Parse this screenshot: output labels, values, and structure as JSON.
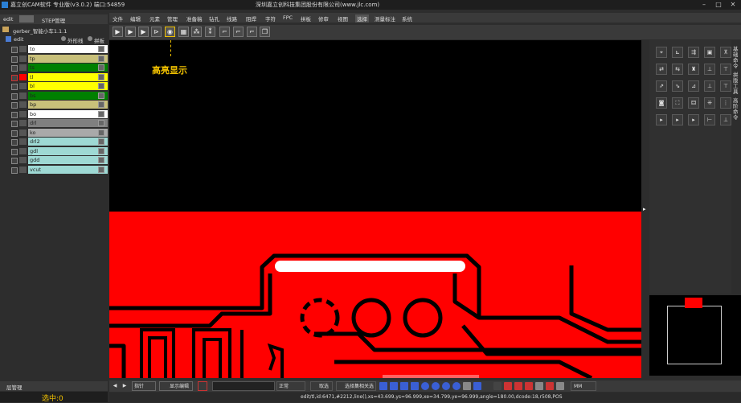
{
  "app": {
    "title": "嘉立创CAM软件 专业版(v3.0.2) 端口:54859",
    "company": "深圳嘉立创科技集团股份有限公司(www.jlc.com)"
  },
  "left": {
    "tabs": [
      "edit",
      "STEP管理"
    ],
    "job_name": "gerber_智能小车1.1.1",
    "step_name": "edit",
    "toggles": [
      "外形线",
      "拼板"
    ],
    "layers": [
      {
        "name": "to",
        "color": "#ffffff"
      },
      {
        "name": "tp",
        "color": "#c8c07a"
      },
      {
        "name": "ts",
        "color": "#008000"
      },
      {
        "name": "tl",
        "color": "#ffff00"
      },
      {
        "name": "bl",
        "color": "#ffff00"
      },
      {
        "name": "bs",
        "color": "#008000"
      },
      {
        "name": "bp",
        "color": "#c8c07a"
      },
      {
        "name": "bo",
        "color": "#ffffff"
      },
      {
        "name": "drl",
        "color": "#808080"
      },
      {
        "name": "ko",
        "color": "#a9a9a9"
      },
      {
        "name": "drl2",
        "color": "#9ed9d4"
      },
      {
        "name": "gdl",
        "color": "#9ed9d4"
      },
      {
        "name": "gdd",
        "color": "#9ed9d4"
      },
      {
        "name": "vcut",
        "color": "#9ed9d4"
      }
    ],
    "bottom_tab": "层管理",
    "selected_label": "选中:0"
  },
  "menu": [
    "文件",
    "编辑",
    "元素",
    "管理",
    "准备稿",
    "钻孔",
    "线路",
    "阻焊",
    "字符",
    "FPC",
    "拼板",
    "修审",
    "视图",
    "选择",
    "测量标注",
    "系统"
  ],
  "annotation": "高亮显示",
  "right_labels": [
    "基础命令",
    "拼版工具",
    "高阶命令"
  ],
  "bottom": {
    "mode": "指针",
    "display_button": "显示编辑层",
    "dropdown": "正常",
    "select_label": "取选",
    "select2_label": "选择集相关选",
    "units": "MM"
  },
  "status": "edit/tl,id:6471,#2212,line(),xs=43.699,ys=96.999,xe=34.799,ye=96.999,angle=180.00,dcode:18,r508,POS",
  "colors": {
    "copper": "#ff0000",
    "highlight": "#ffffff",
    "annotation": "#f0c000"
  }
}
